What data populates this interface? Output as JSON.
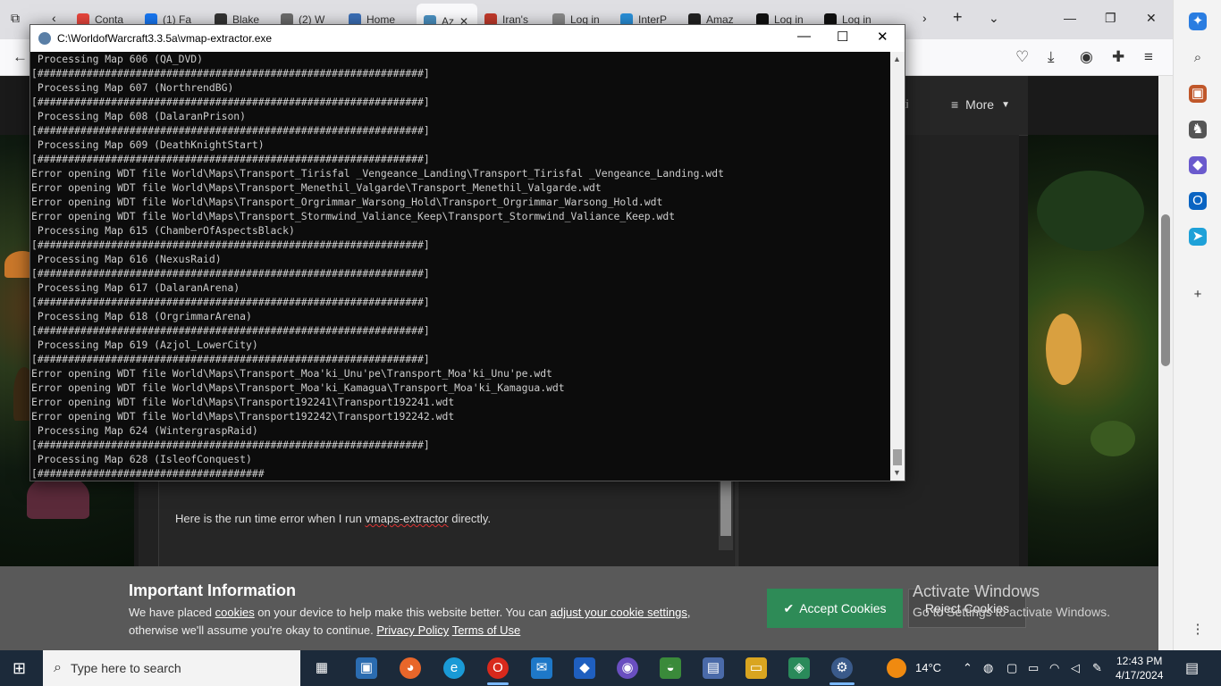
{
  "browser": {
    "tabs": [
      {
        "label": "Conta",
        "color": "#e8453c"
      },
      {
        "label": "(1) Fa",
        "color": "#1877f2"
      },
      {
        "label": "Blake",
        "color": "#333333"
      },
      {
        "label": "(2) W",
        "color": "#6b6b6b"
      },
      {
        "label": "Home",
        "color": "#3b6fb6"
      },
      {
        "label": "Az",
        "color": "#4a90c0"
      },
      {
        "label": "Iran's",
        "color": "#c0392b"
      },
      {
        "label": "Log in",
        "color": "#888888"
      },
      {
        "label": "InterP",
        "color": "#2a8fd8"
      },
      {
        "label": "Amaz",
        "color": "#222222"
      },
      {
        "label": "Log in",
        "color": "#111111"
      },
      {
        "label": "Log in",
        "color": "#111111"
      }
    ],
    "new_tab": "+",
    "nav_icons": [
      "back-icon",
      "pocket-icon",
      "download-icon",
      "account-icon",
      "extensions-icon",
      "menu-icon"
    ]
  },
  "site": {
    "header_partial": "ti",
    "more_label": "More",
    "post_text_before": "Here is the run time error when I run ",
    "post_text_link": "vmaps-extractor",
    "post_text_after": " directly."
  },
  "cookie": {
    "title": "Important Information",
    "msg_1": "We have placed ",
    "link_cookies": "cookies",
    "msg_2": " on your device to help make this website better. You can ",
    "link_adjust": "adjust your cookie settings",
    "msg_3": ", otherwise we'll assume you're okay to continue. ",
    "link_privacy": "Privacy Policy",
    "link_terms": "Terms of Use",
    "accept": "Accept Cookies",
    "reject": "Reject Cookies"
  },
  "activate": {
    "line1": "Activate Windows",
    "line2": "Go to Settings to activate Windows."
  },
  "console": {
    "title": "C:\\WorldofWarcraft3.3.5a\\vmap-extractor.exe",
    "lines": [
      " Processing Map 606 (QA_DVD)",
      "[###############################################################]",
      " Processing Map 607 (NorthrendBG)",
      "[###############################################################]",
      " Processing Map 608 (DalaranPrison)",
      "[###############################################################]",
      " Processing Map 609 (DeathKnightStart)",
      "[###############################################################]",
      "Error opening WDT file World\\Maps\\Transport_Tirisfal _Vengeance_Landing\\Transport_Tirisfal _Vengeance_Landing.wdt",
      "Error opening WDT file World\\Maps\\Transport_Menethil_Valgarde\\Transport_Menethil_Valgarde.wdt",
      "Error opening WDT file World\\Maps\\Transport_Orgrimmar_Warsong_Hold\\Transport_Orgrimmar_Warsong_Hold.wdt",
      "Error opening WDT file World\\Maps\\Transport_Stormwind_Valiance_Keep\\Transport_Stormwind_Valiance_Keep.wdt",
      " Processing Map 615 (ChamberOfAspectsBlack)",
      "[###############################################################]",
      " Processing Map 616 (NexusRaid)",
      "[###############################################################]",
      " Processing Map 617 (DalaranArena)",
      "[###############################################################]",
      " Processing Map 618 (OrgrimmarArena)",
      "[###############################################################]",
      " Processing Map 619 (Azjol_LowerCity)",
      "[###############################################################]",
      "Error opening WDT file World\\Maps\\Transport_Moa'ki_Unu'pe\\Transport_Moa'ki_Unu'pe.wdt",
      "Error opening WDT file World\\Maps\\Transport_Moa'ki_Kamagua\\Transport_Moa'ki_Kamagua.wdt",
      "Error opening WDT file World\\Maps\\Transport192241\\Transport192241.wdt",
      "Error opening WDT file World\\Maps\\Transport192242\\Transport192242.wdt",
      " Processing Map 624 (WintergraspRaid)",
      "[###############################################################]",
      " Processing Map 628 (IsleofConquest)",
      "[#####################################"
    ]
  },
  "taskbar": {
    "search_placeholder": "Type here to search",
    "weather": "14°C",
    "time": "12:43 PM",
    "date": "4/17/2024"
  }
}
